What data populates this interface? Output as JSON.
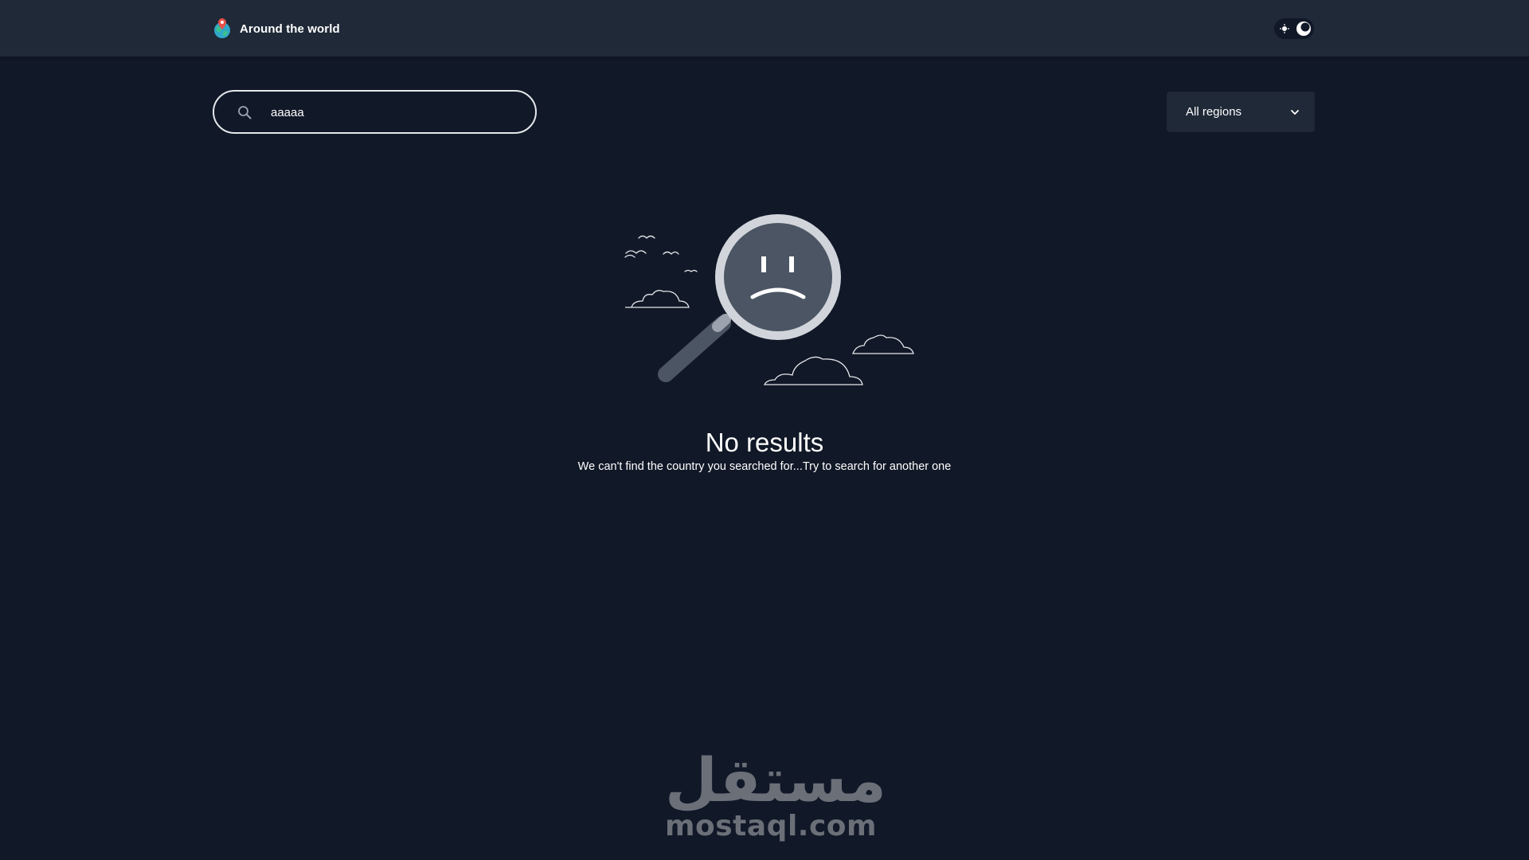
{
  "header": {
    "app_title": "Around the world",
    "logo_icon": "globe-pin-icon",
    "theme_toggle": {
      "light_icon": "sun-icon",
      "dark_icon": "moon-icon",
      "active": "dark"
    }
  },
  "toolbar": {
    "search": {
      "icon": "search-icon",
      "value": "aaaaa",
      "placeholder": ""
    },
    "region_filter": {
      "selected": "All regions",
      "icon": "chevron-down-icon"
    }
  },
  "empty_state": {
    "illustration": "sad-magnifier-illustration",
    "title": "No results",
    "message": "We can't find the country you searched for...Try to search for another one"
  },
  "watermark": {
    "arabic": "مستقل",
    "latin": "mostaql.com"
  },
  "colors": {
    "background": "#111827",
    "surface": "#1f2937",
    "text": "#ffffff"
  }
}
